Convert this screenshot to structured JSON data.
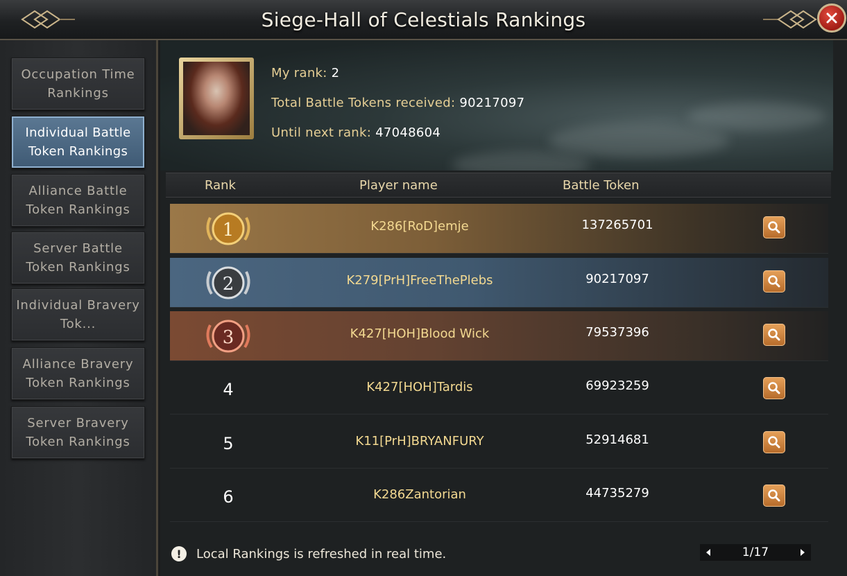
{
  "window": {
    "title": "Siege-Hall of Celestials Rankings"
  },
  "sidebar": {
    "tabs": [
      {
        "label": "Occupation Time Rankings",
        "active": false
      },
      {
        "label": "Individual Battle Token Rankings",
        "active": true
      },
      {
        "label": "Alliance Battle Token Rankings",
        "active": false
      },
      {
        "label": "Server Battle Token Rankings",
        "active": false
      },
      {
        "label": "Individual Bravery Tok...",
        "active": false
      },
      {
        "label": "Alliance Bravery Token Rankings",
        "active": false
      },
      {
        "label": "Server Bravery Token Rankings",
        "active": false
      }
    ]
  },
  "profile": {
    "my_rank_label": "My rank:",
    "my_rank_value": "2",
    "total_label": "Total Battle Tokens received:",
    "total_value": "90217097",
    "next_label": "Until next rank:",
    "next_value": "47048604"
  },
  "table": {
    "headers": {
      "rank": "Rank",
      "player": "Player name",
      "token": "Battle Token"
    },
    "rows": [
      {
        "rank": "1",
        "player": "K286[RoD]emje",
        "token": "137265701"
      },
      {
        "rank": "2",
        "player": "K279[PrH]FreeThePlebs",
        "token": "90217097"
      },
      {
        "rank": "3",
        "player": "K427[HOH]Blood Wick",
        "token": "79537396"
      },
      {
        "rank": "4",
        "player": "K427[HOH]Tardis",
        "token": "69923259"
      },
      {
        "rank": "5",
        "player": "K11[PrH]BRYANFURY",
        "token": "52914681"
      },
      {
        "rank": "6",
        "player": "K286Zantorian",
        "token": "44735279"
      }
    ]
  },
  "footer": {
    "note": "Local Rankings is refreshed in real time.",
    "warn_icon_glyph": "!",
    "page": "1/17"
  },
  "colors": {
    "gold_text": "#f3d991",
    "active_tab": "#4f6e8b",
    "close_button": "#c0281f",
    "view_button": "#d08a44"
  }
}
